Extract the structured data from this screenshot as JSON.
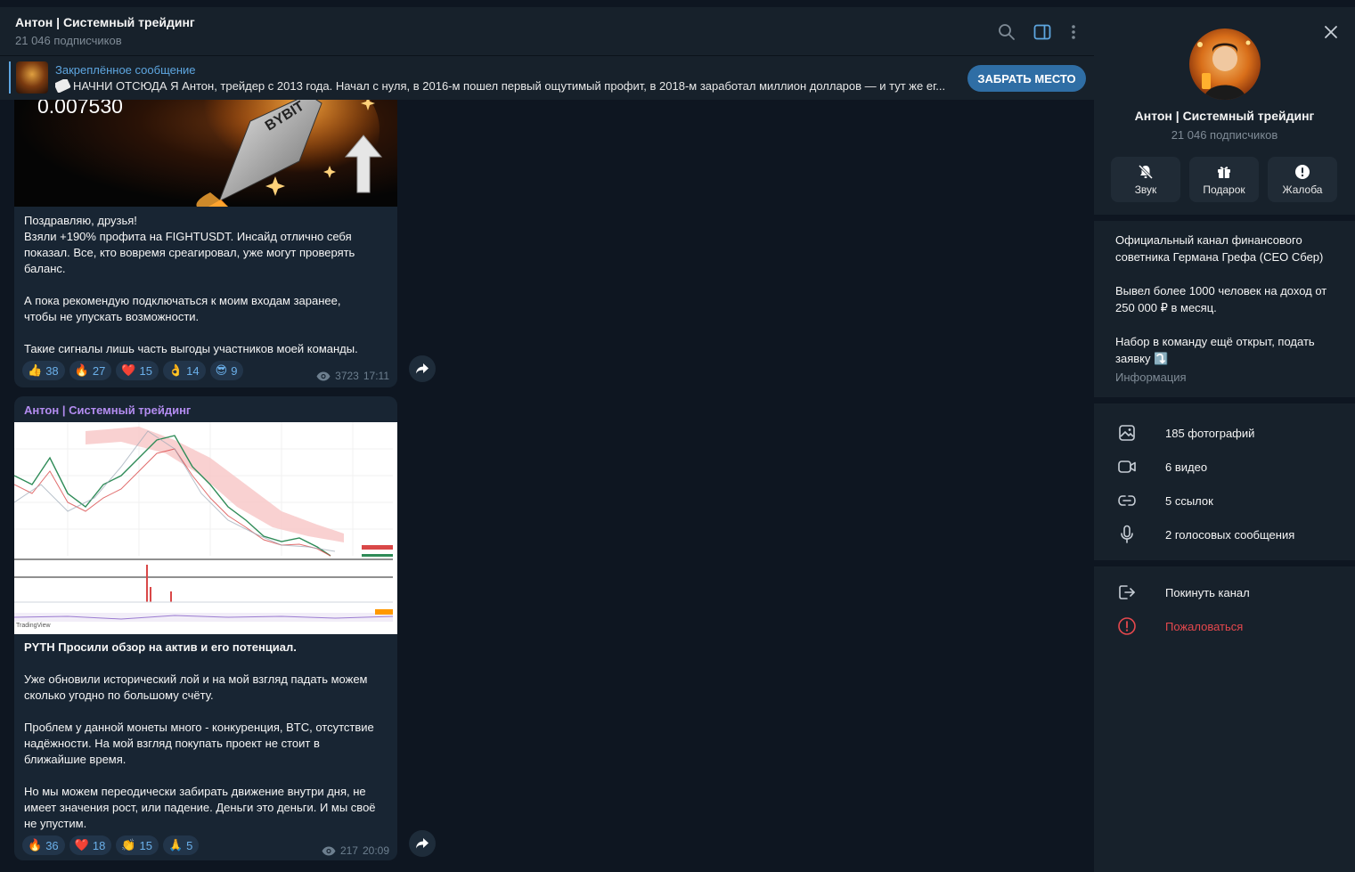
{
  "header": {
    "title": "Антон | Системный трейдинг",
    "subscribers": "21 046 подписчиков"
  },
  "pinned": {
    "title": "Закреплённое сообщение",
    "text": "НАЧНИ ОТСЮДА  Я Антон, трейдер с 2013 года. Начал с нуля, в 2016-м пошел первый ощутимый профит, в 2018-м заработал миллион долларов — и тут же ег...",
    "button": "ЗАБРАТЬ МЕСТО"
  },
  "post1": {
    "image_price": "0.007530",
    "image_label": "BYBIT",
    "lines": [
      "Поздравляю, друзья!",
      "Взяли +190% профита на FIGHTUSDT. Инсайд отлично себя",
      "показал. Все, кто вовремя среагировал, уже могут проверять",
      "баланс.",
      "",
      "А пока рекомендую подключаться к моим входам заранее,",
      "чтобы не упускать возможности.",
      "",
      "Такие сигналы лишь часть выгоды участников моей команды."
    ],
    "reactions": [
      {
        "emoji": "👍",
        "count": "38"
      },
      {
        "emoji": "🔥",
        "count": "27"
      },
      {
        "emoji": "❤️",
        "count": "15"
      },
      {
        "emoji": "👌",
        "count": "14"
      },
      {
        "emoji": "😎",
        "count": "9"
      }
    ],
    "views": "3723",
    "time": "17:11"
  },
  "post2": {
    "author": "Антон | Системный трейдинг",
    "chart_footer": "TradingView",
    "lines": [
      "PYTH Просили обзор на актив и его потенциал.",
      "",
      "Уже обновили исторический лой и на мой взгляд падать можем",
      "сколько угодно по большому счёту.",
      "",
      "Проблем у данной монеты много - конкуренция, BTC, отсутствие",
      "надёжности. На мой взгляд покупать проект не стоит в",
      "ближайшие время.",
      "",
      "Но мы можем переодически забирать движение внутри дня, не",
      "имеет значения рост, или падение. Деньги это деньги. И мы своё",
      "не упустим."
    ],
    "reactions": [
      {
        "emoji": "🔥",
        "count": "36"
      },
      {
        "emoji": "❤️",
        "count": "18"
      },
      {
        "emoji": "👏",
        "count": "15"
      },
      {
        "emoji": "🙏",
        "count": "5"
      }
    ],
    "views": "217",
    "time": "20:09"
  },
  "side": {
    "title": "Антон | Системный трейдинг",
    "subscribers": "21 046 подписчиков",
    "buttons": [
      {
        "label": "Звук",
        "icon": "mute-bell-icon"
      },
      {
        "label": "Подарок",
        "icon": "gift-icon"
      },
      {
        "label": "Жалоба",
        "icon": "warning-icon"
      }
    ],
    "description": [
      "Официальный канал финансового советника Германа Грефа (CEO Сбер)",
      "Вывел более 1000 человек на доход от 250 000 ₽ в месяц.",
      "Набор в команду ещё открыт, подать заявку ⤵️"
    ],
    "info_label": "Информация",
    "media": [
      {
        "label": "185 фотографий",
        "icon": "photo-icon"
      },
      {
        "label": "6 видео",
        "icon": "video-icon"
      },
      {
        "label": "5 ссылок",
        "icon": "link-icon"
      },
      {
        "label": "2 голосовых сообщения",
        "icon": "microphone-icon"
      }
    ],
    "leave": "Покинуть канал",
    "report": "Пожаловаться"
  },
  "colors": {
    "accent": "#5ea6e0",
    "danger": "#e5484d",
    "author": "#b38cf0"
  }
}
